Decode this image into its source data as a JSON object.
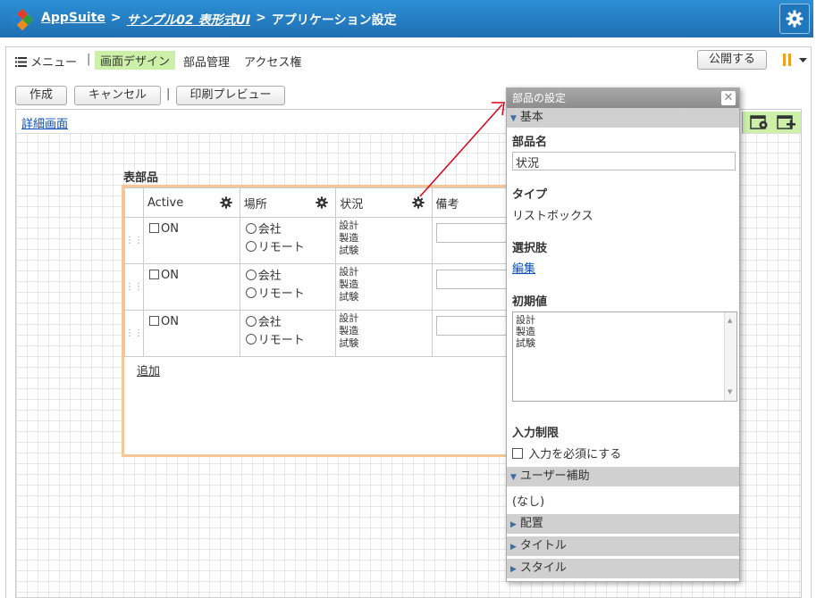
{
  "header": {
    "app_name": "AppSuite",
    "sep1": ">",
    "app_title": "サンプル02 表形式UI",
    "sep2": ">",
    "page_title": "アプリケーション設定"
  },
  "menubar": {
    "menu_label": "メニュー",
    "divider": "|",
    "tabs": [
      "画面デザイン",
      "部品管理",
      "アクセス権"
    ],
    "publish_label": "公開する"
  },
  "toolbar": {
    "create_label": "作成",
    "cancel_label": "キャンセル",
    "divider": "|",
    "print_label": "印刷プレビュー"
  },
  "canvas": {
    "detail_link": "詳細画面",
    "table_title": "表部品",
    "add_label": "追加",
    "columns": [
      "Active",
      "場所",
      "状況",
      "備考"
    ],
    "rows": [
      {
        "active": "ON",
        "place": [
          "会社",
          "リモート"
        ],
        "status": [
          "設計",
          "製造",
          "試験"
        ]
      },
      {
        "active": "ON",
        "place": [
          "会社",
          "リモート"
        ],
        "status": [
          "設計",
          "製造",
          "試験"
        ]
      },
      {
        "active": "ON",
        "place": [
          "会社",
          "リモート"
        ],
        "status": [
          "設計",
          "製造",
          "試験"
        ]
      }
    ]
  },
  "panel": {
    "title": "部品の設定",
    "close": "✕",
    "sections": {
      "basic": "基本",
      "assist": "ユーザー補助",
      "layout": "配置",
      "title": "タイトル",
      "style": "スタイル"
    },
    "part_name_label": "部品名",
    "part_name_value": "状況",
    "type_label": "タイプ",
    "type_value": "リストボックス",
    "choices_label": "選択肢",
    "edit_link": "編集",
    "initial_label": "初期値",
    "initial_values": [
      "設計",
      "製造",
      "試験"
    ],
    "input_limit_label": "入力制限",
    "required_label": "入力を必須にする",
    "assist_value": "(なし)"
  },
  "colors": {
    "header_blue": "#1f6fb0",
    "active_green": "#ccf0a8",
    "table_border": "#f6c796",
    "arrow_red": "#e0001a"
  }
}
